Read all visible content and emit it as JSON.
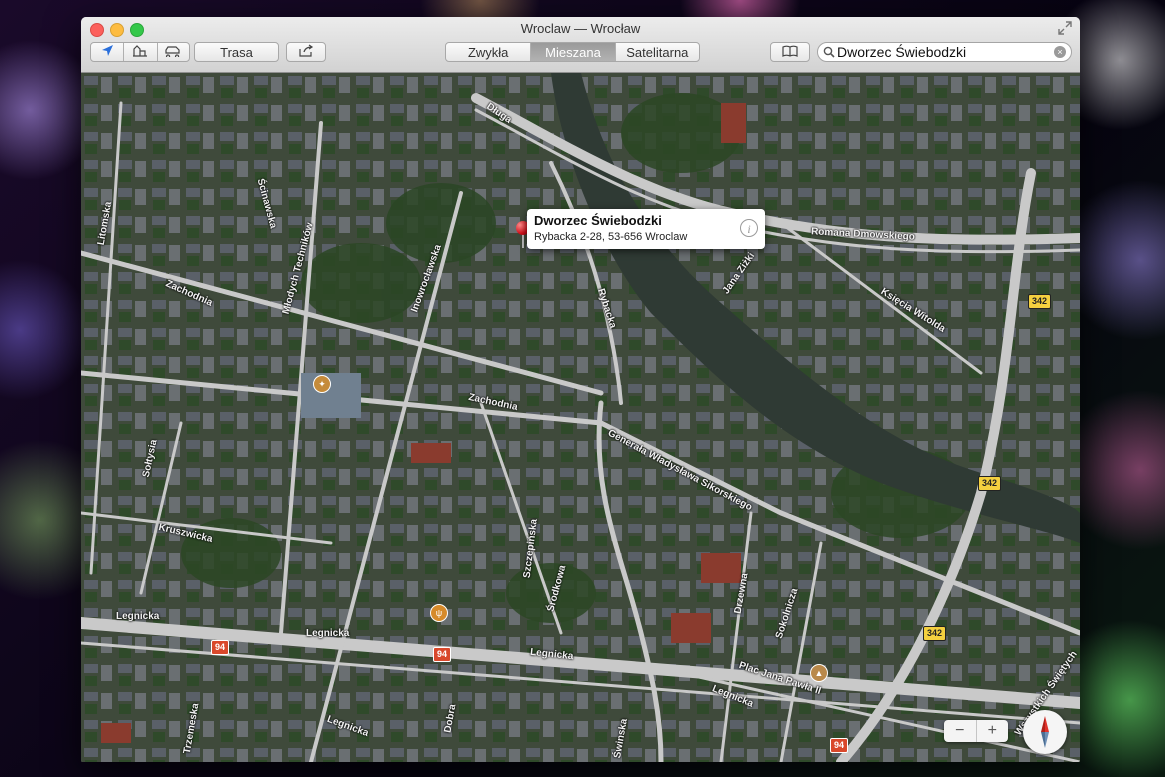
{
  "window": {
    "title": "Wroclaw — Wrocław"
  },
  "toolbar": {
    "route_label": "Trasa",
    "map_modes": [
      {
        "label": "Zwykła",
        "active": false
      },
      {
        "label": "Mieszana",
        "active": true
      },
      {
        "label": "Satelitarna",
        "active": false
      }
    ],
    "search": {
      "value": "Dworzec Świebodzki"
    }
  },
  "map": {
    "callout": {
      "title": "Dworzec Świebodzki",
      "subtitle": "Rybacka 2-28, 53-656 Wroclaw"
    },
    "streets": [
      {
        "label": "Długa"
      },
      {
        "label": "Litomska"
      },
      {
        "label": "Ścinawska"
      },
      {
        "label": "Młodych Techników"
      },
      {
        "label": "Inowrocławska"
      },
      {
        "label": "Zachodnia"
      },
      {
        "label": "Zachodnia"
      },
      {
        "label": "Rybacka"
      },
      {
        "label": "Romana Dmowskiego"
      },
      {
        "label": "Jana Ziżki"
      },
      {
        "label": "Księcia Witolda"
      },
      {
        "label": "Generała Władysława Sikorskiego"
      },
      {
        "label": "Sołtysia"
      },
      {
        "label": "Kruszwicka"
      },
      {
        "label": "Szczepińska"
      },
      {
        "label": "Środkowa"
      },
      {
        "label": "Drzewna"
      },
      {
        "label": "Sokolnicza"
      },
      {
        "label": "Legnicka"
      },
      {
        "label": "Legnicka"
      },
      {
        "label": "Legnicka"
      },
      {
        "label": "Legnicka"
      },
      {
        "label": "Legnicka"
      },
      {
        "label": "Plac Jana Pawła II"
      },
      {
        "label": "Trzemeska"
      },
      {
        "label": "Dobra"
      },
      {
        "label": "Świnska"
      },
      {
        "label": "Wszystkich Świętych"
      }
    ],
    "shields": [
      {
        "label": "94",
        "type": "red"
      },
      {
        "label": "94",
        "type": "red"
      },
      {
        "label": "94",
        "type": "red"
      },
      {
        "label": "342",
        "type": "yellow"
      },
      {
        "label": "342",
        "type": "yellow"
      },
      {
        "label": "342",
        "type": "yellow"
      }
    ],
    "zoom": {
      "minus": "−",
      "plus": "+"
    }
  },
  "icons": {
    "location": "location-arrow-icon",
    "view_3d": "buildings-3d-icon",
    "traffic": "car-traffic-icon",
    "share": "share-icon",
    "bookmarks": "bookmarks-book-icon",
    "search": "search-icon",
    "clear": "clear-search-icon",
    "compass": "compass-icon",
    "pin": "red-map-pin"
  },
  "colors": {
    "pin": "#d0101a",
    "shield_red": "#d9482b",
    "shield_yellow": "#f4d03f",
    "river": "#2f3a34"
  }
}
